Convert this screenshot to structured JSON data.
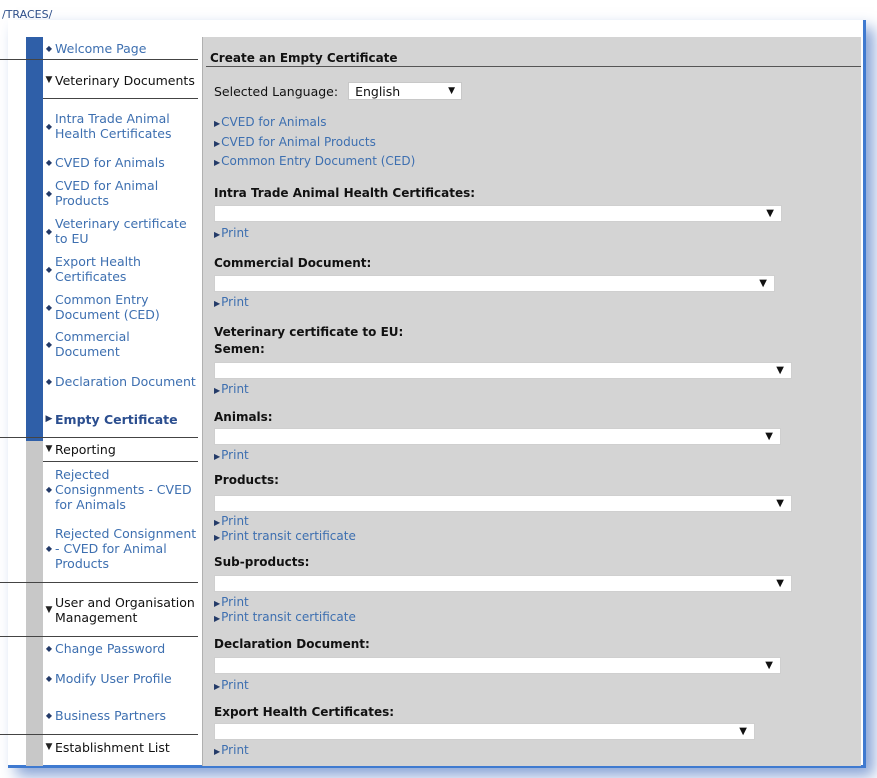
{
  "breadcrumb": "/TRACES/",
  "sidebar": {
    "welcome": "Welcome Page",
    "veterinary_documents": "Veterinary Documents",
    "vet_items": [
      "Intra Trade Animal Health Certificates",
      "CVED for Animals",
      "CVED for Animal Products",
      "Veterinary certificate to EU",
      "Export Health Certificates",
      "Common Entry Document (CED)",
      "Commercial Document",
      "Declaration Document",
      "Empty Certificate"
    ],
    "reporting": "Reporting",
    "reporting_items": [
      "Rejected Consignments - CVED for Animals",
      "Rejected Consignment - CVED for Animal Products"
    ],
    "user_org": "User and Organisation Management",
    "user_items": [
      "Change Password",
      "Modify User Profile",
      "Business Partners"
    ],
    "establishment": "Establishment List"
  },
  "main": {
    "title": "Create an Empty Certificate",
    "language_label": "Selected Language:",
    "language_value": "English",
    "top_links": [
      "CVED for Animals",
      "CVED for Animal Products",
      "Common Entry Document (CED)"
    ],
    "print": "Print",
    "print_transit": "Print transit certificate",
    "sections": {
      "intra_trade": "Intra Trade Animal Health Certificates:",
      "commercial": "Commercial Document:",
      "vet_cert": "Veterinary certificate to EU:",
      "semen": "Semen:",
      "animals": "Animals:",
      "products": "Products:",
      "sub_products": "Sub-products:",
      "declaration": "Declaration Document:",
      "export": "Export Health Certificates:"
    }
  },
  "colors": {
    "link": "#3d6fb0",
    "nav_stripe": "#2f5fa8",
    "panel_bg": "#d4d4d4",
    "glow": "#3f7ad0"
  }
}
